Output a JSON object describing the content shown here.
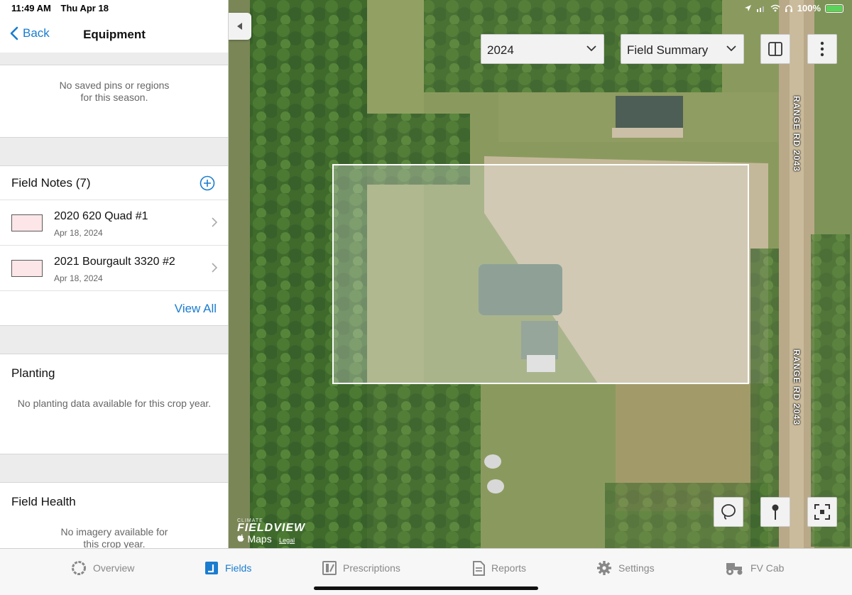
{
  "status": {
    "time": "11:49 AM",
    "date": "Thu Apr 18",
    "battery": "100%"
  },
  "nav": {
    "back_label": "Back",
    "title": "Equipment"
  },
  "pins": {
    "empty_line1": "No saved pins or regions",
    "empty_line2": "for this season."
  },
  "field_notes": {
    "title": "Field Notes (7)",
    "items": [
      {
        "title": "2020 620 Quad #1",
        "date": "Apr 18, 2024"
      },
      {
        "title": "2021 Bourgault 3320 #2",
        "date": "Apr 18, 2024"
      }
    ],
    "view_all_label": "View All"
  },
  "planting": {
    "title": "Planting",
    "empty_text": "No planting data available for this crop year."
  },
  "field_health": {
    "title": "Field Health",
    "empty_line1": "No imagery available for",
    "empty_line2": "this crop year."
  },
  "map": {
    "year_value": "2024",
    "layer_value": "Field Summary",
    "road_label_upper": "RANGE RD 2043",
    "road_label_lower": "RANGE RD 2043",
    "logo_top": "CLIMATE",
    "logo_main": "FIELDVIEW",
    "maps_label": "Maps",
    "legal_label": "Legal"
  },
  "tabs": [
    {
      "label": "Overview",
      "icon": "overview-ring-icon"
    },
    {
      "label": "Fields",
      "icon": "fields-icon"
    },
    {
      "label": "Prescriptions",
      "icon": "prescriptions-icon"
    },
    {
      "label": "Reports",
      "icon": "reports-icon"
    },
    {
      "label": "Settings",
      "icon": "gear-icon"
    },
    {
      "label": "FV Cab",
      "icon": "tractor-icon"
    }
  ],
  "colors": {
    "accent": "#1a7ccf",
    "note_thumb_fill": "#fde6e8"
  }
}
